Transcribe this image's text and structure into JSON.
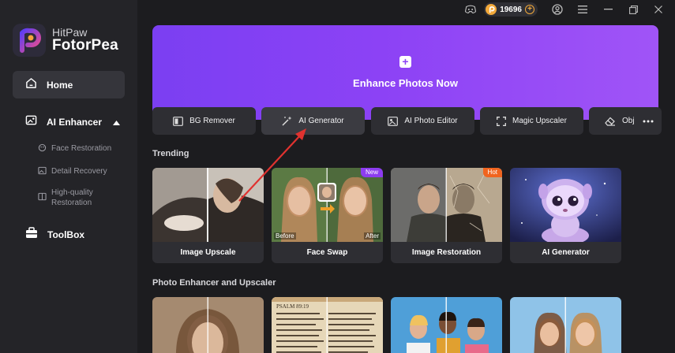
{
  "app": {
    "brand": "HitPaw",
    "product": "FotorPea"
  },
  "sidebar": {
    "home_label": "Home",
    "ai_enhancer_label": "AI Enhancer",
    "sub_items": [
      {
        "label": "Face Restoration"
      },
      {
        "label": "Detail Recovery"
      },
      {
        "label": "High-quality Restoration"
      }
    ],
    "toolbox_label": "ToolBox"
  },
  "titlebar": {
    "coins": "19696"
  },
  "banner": {
    "label": "Enhance Photos Now"
  },
  "tools": [
    {
      "label": "BG Remover",
      "icon": "bg-remover-icon"
    },
    {
      "label": "AI Generator",
      "icon": "magic-wand-icon"
    },
    {
      "label": "AI Photo Editor",
      "icon": "photo-edit-icon"
    },
    {
      "label": "Magic Upscaler",
      "icon": "expand-icon"
    },
    {
      "label": "Obj",
      "icon": "eraser-icon"
    }
  ],
  "sections": {
    "trending": "Trending",
    "photo_enhancer": "Photo Enhancer and Upscaler"
  },
  "trending_cards": [
    {
      "label": "Image Upscale"
    },
    {
      "label": "Face Swap",
      "badge": "New",
      "before": "Before",
      "after": "After"
    },
    {
      "label": "Image Restoration",
      "badge": "Hot"
    },
    {
      "label": "AI Generator"
    }
  ],
  "colors": {
    "accent_purple": "#8c42f5",
    "badge_new": "#8d3cf0",
    "badge_hot": "#f0641e",
    "annotation_arrow": "#e0322f"
  }
}
